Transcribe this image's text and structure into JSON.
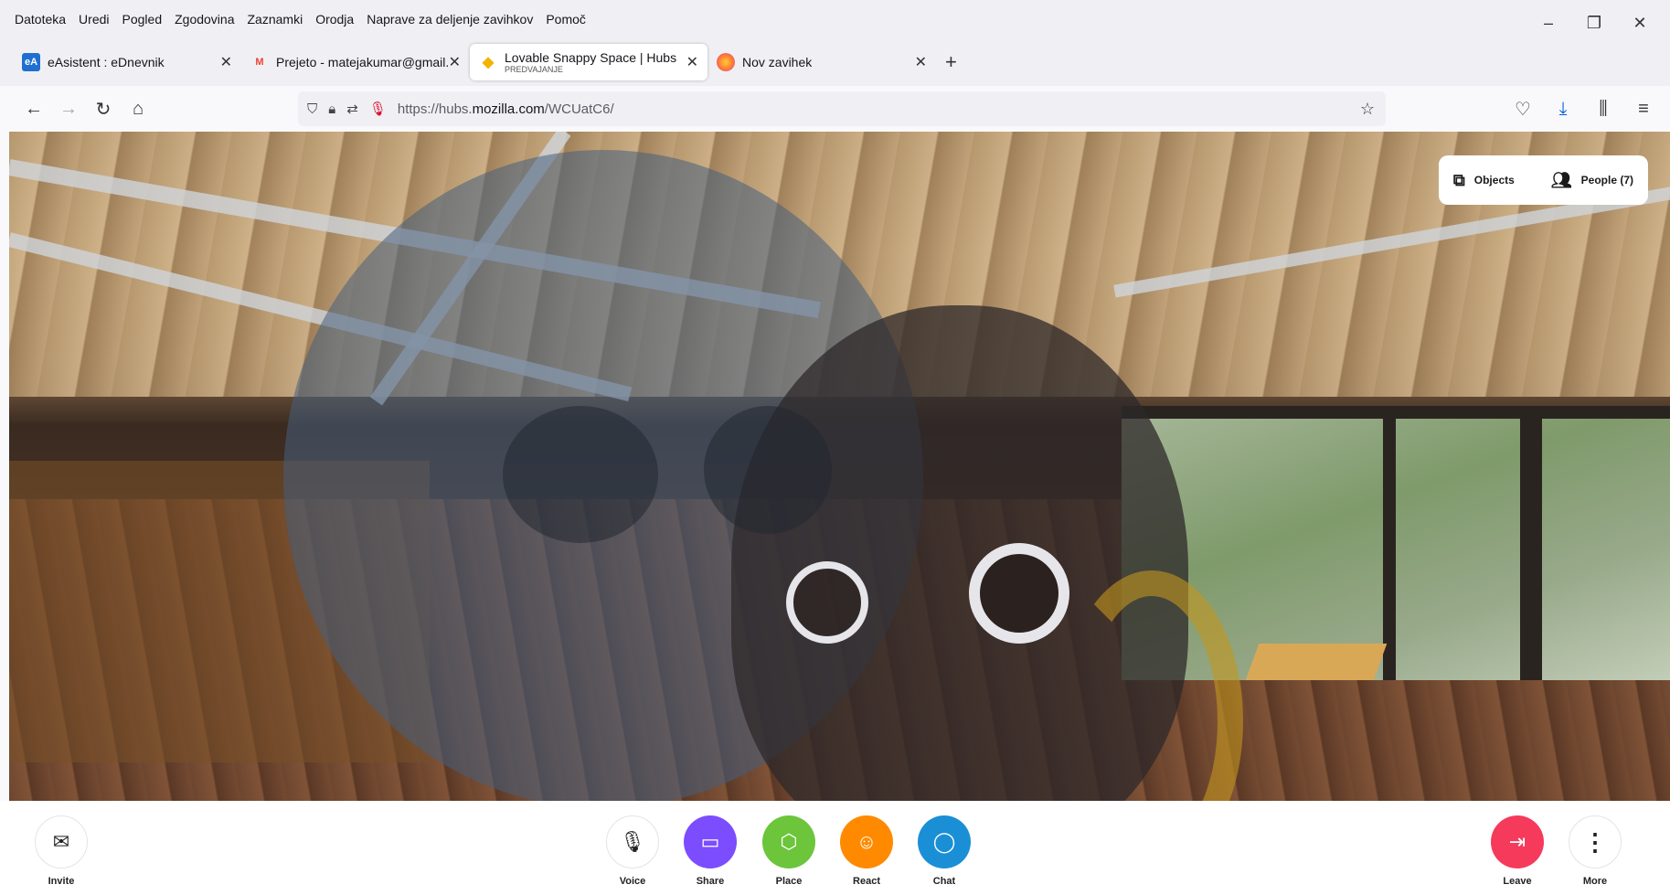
{
  "menu": [
    "Datoteka",
    "Uredi",
    "Pogled",
    "Zgodovina",
    "Zaznamki",
    "Orodja",
    "Naprave za deljenje zavihkov",
    "Pomoč"
  ],
  "tabs": [
    {
      "label": "eAsistent : eDnevnik",
      "favicon": "eA",
      "favicon_color": "#1e6fd0"
    },
    {
      "label": "Prejeto - matejakumar@gmail.c",
      "favicon": "M",
      "favicon_color": "#ea4335"
    },
    {
      "label": "Lovable Snappy Space | Hubs b",
      "sub": "PREDVAJANJE",
      "favicon": "hubs-duck-icon",
      "favicon_color": "#f2b400"
    },
    {
      "label": "Nov zavihek",
      "favicon": "firefox-icon",
      "favicon_color": "#ff7139"
    }
  ],
  "url": {
    "prefix": "https://hubs.",
    "host": "mozilla.com",
    "path": "/WCUatC6/"
  },
  "panel": {
    "objects": "Objects",
    "people": "People (7)"
  },
  "toolbar": {
    "invite": "Invite",
    "voice": "Voice",
    "share": "Share",
    "place": "Place",
    "react": "React",
    "chat": "Chat",
    "leave": "Leave",
    "more": "More"
  },
  "colors": {
    "share": "#7b4dff",
    "place": "#6cc53b",
    "react": "#ff8a00",
    "chat": "#1a8fd6",
    "leave": "#f53a5b"
  }
}
